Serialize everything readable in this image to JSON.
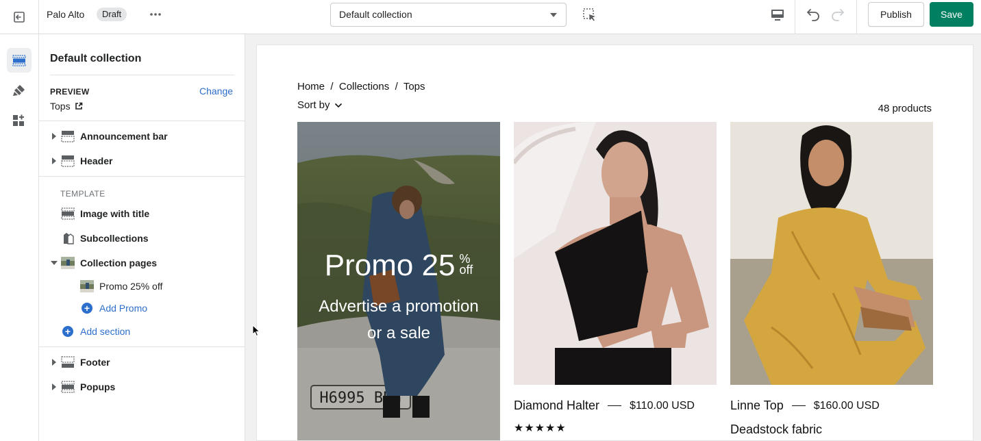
{
  "topbar": {
    "store_name": "Palo Alto",
    "status_badge": "Draft",
    "template_select_value": "Default collection",
    "publish_label": "Publish",
    "save_label": "Save"
  },
  "rail": {
    "icons": [
      "sections-icon",
      "theme-settings-icon",
      "app-embeds-icon"
    ]
  },
  "sidebar": {
    "title": "Default collection",
    "preview_label": "PREVIEW",
    "preview_change": "Change",
    "preview_value": "Tops",
    "header_group": [
      {
        "label": "Announcement bar"
      },
      {
        "label": "Header"
      }
    ],
    "template_label": "TEMPLATE",
    "template_sections": [
      {
        "label": "Image with title"
      },
      {
        "label": "Subcollections"
      },
      {
        "label": "Collection pages"
      }
    ],
    "collection_pages_children": [
      {
        "label": "Promo 25% off"
      }
    ],
    "add_promo": "Add Promo",
    "add_section": "Add section",
    "footer_group": [
      {
        "label": "Footer"
      },
      {
        "label": "Popups"
      }
    ]
  },
  "preview": {
    "breadcrumb": [
      "Home",
      "/",
      "Collections",
      "/",
      "Tops"
    ],
    "sort_by": "Sort by",
    "product_count": "48 products",
    "promo": {
      "title": "Promo 25",
      "pct_top": "%",
      "pct_bottom": "off",
      "subtitle": "Advertise a promotion or a sale",
      "plate": "H6995 BBG"
    },
    "products": [
      {
        "name": "Diamond Halter",
        "price": "$110.00 USD",
        "rating": "★★★★★"
      },
      {
        "name": "Linne Top",
        "price": "$160.00 USD",
        "description": "Deadstock fabric"
      }
    ]
  },
  "colors": {
    "accent": "#008060",
    "link": "#2c6ecb"
  }
}
